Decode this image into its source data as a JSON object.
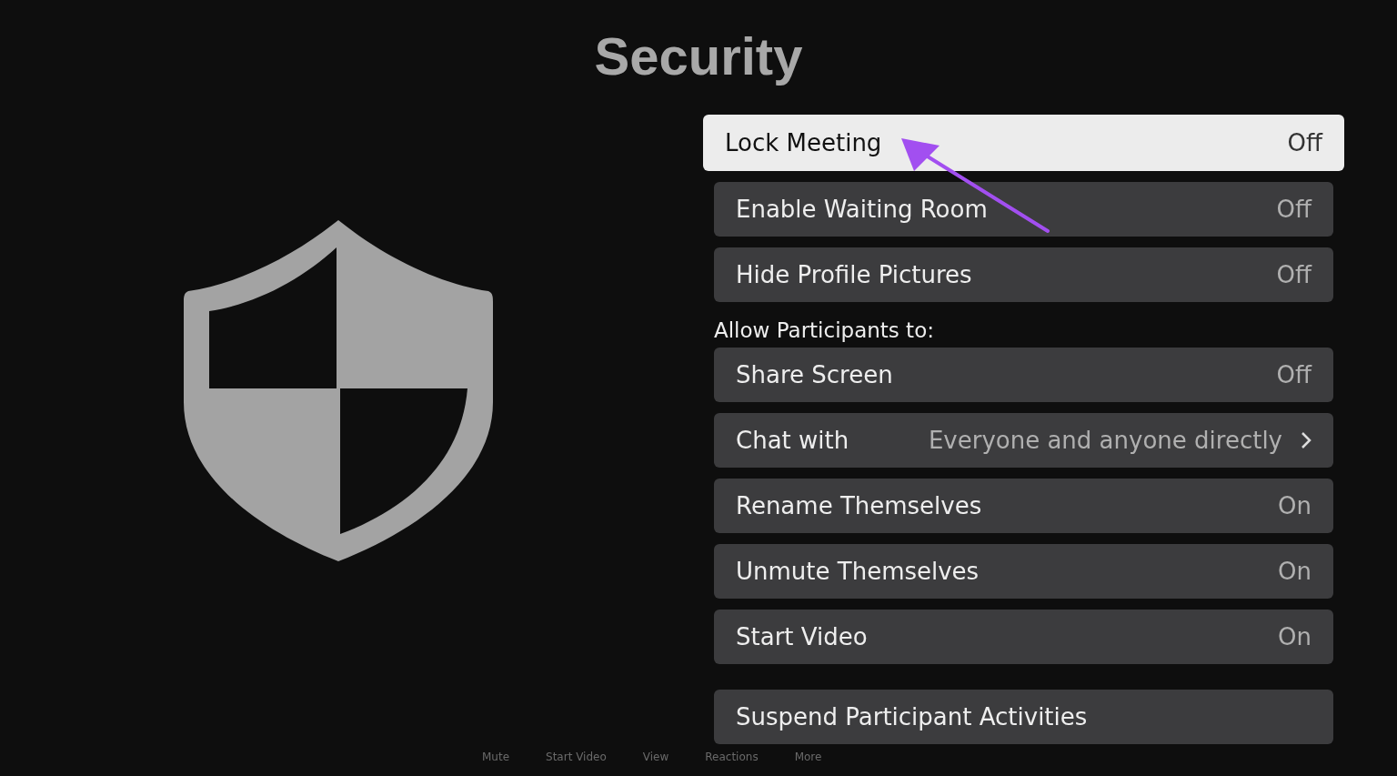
{
  "title": "Security",
  "items": [
    {
      "kind": "setting",
      "label": "Lock Meeting",
      "value": "Off",
      "selected": true
    },
    {
      "kind": "setting",
      "label": "Enable Waiting Room",
      "value": "Off",
      "selected": false
    },
    {
      "kind": "setting",
      "label": "Hide Profile Pictures",
      "value": "Off",
      "selected": false
    },
    {
      "kind": "header",
      "label": "Allow Participants to:"
    },
    {
      "kind": "setting",
      "label": "Share Screen",
      "value": "Off",
      "selected": false
    },
    {
      "kind": "link",
      "label": "Chat with",
      "value": "Everyone and anyone directly",
      "selected": false
    },
    {
      "kind": "setting",
      "label": "Rename Themselves",
      "value": "On",
      "selected": false
    },
    {
      "kind": "setting",
      "label": "Unmute Themselves",
      "value": "On",
      "selected": false
    },
    {
      "kind": "setting",
      "label": "Start Video",
      "value": "On",
      "selected": false
    },
    {
      "kind": "action",
      "label": "Suspend Participant Activities",
      "selected": false
    }
  ],
  "toolbar": [
    "Mute",
    "Start Video",
    "View",
    "Reactions",
    "More"
  ]
}
